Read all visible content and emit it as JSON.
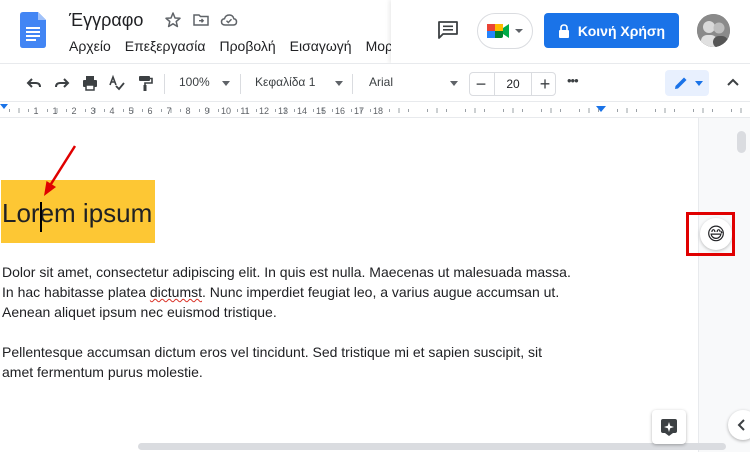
{
  "header": {
    "title": "Έγγραφο",
    "menu": [
      "Αρχείο",
      "Επεξεργασία",
      "Προβολή",
      "Εισαγωγή",
      "Μορφή"
    ],
    "share_label": "Κοινή Χρήση",
    "icons": [
      "star-icon",
      "move-folder-icon",
      "cloud-status-icon",
      "comment-icon",
      "meet-icon",
      "lock-icon"
    ]
  },
  "toolbar": {
    "zoom": "100%",
    "style": "Κεφαλίδα 1",
    "font": "Arial",
    "font_size": "20",
    "minus": "−",
    "plus": "+",
    "more": "•••"
  },
  "ruler": {
    "numbers": [
      "1",
      "1",
      "2",
      "3",
      "4",
      "5",
      "6",
      "7",
      "8",
      "9",
      "10",
      "11",
      "12",
      "13",
      "14",
      "15",
      "16",
      "17",
      "18"
    ]
  },
  "document": {
    "heading": "Lorem ipsum",
    "para1_a": "Dolor sit amet, consectetur adipiscing elit. In quis est nulla. Maecenas ut malesuada massa.",
    "para1_b": "In hac habitasse platea ",
    "para1_misspelled": "dictumst",
    "para1_c": ". Nunc imperdiet feugiat leo, a varius augue accumsan ut.",
    "para1_d": "Aenean aliquet ipsum nec euismod tristique.",
    "para2_a": "Pellentesque accumsan dictum eros vel tincidunt. Sed tristique mi et sapien suscipit, sit",
    "para2_b": "amet fermentum purus molestie."
  },
  "emoji": "😅",
  "colors": {
    "accent": "#1a73e8",
    "highlight": "#fdc734",
    "annotation": "#e00000"
  }
}
